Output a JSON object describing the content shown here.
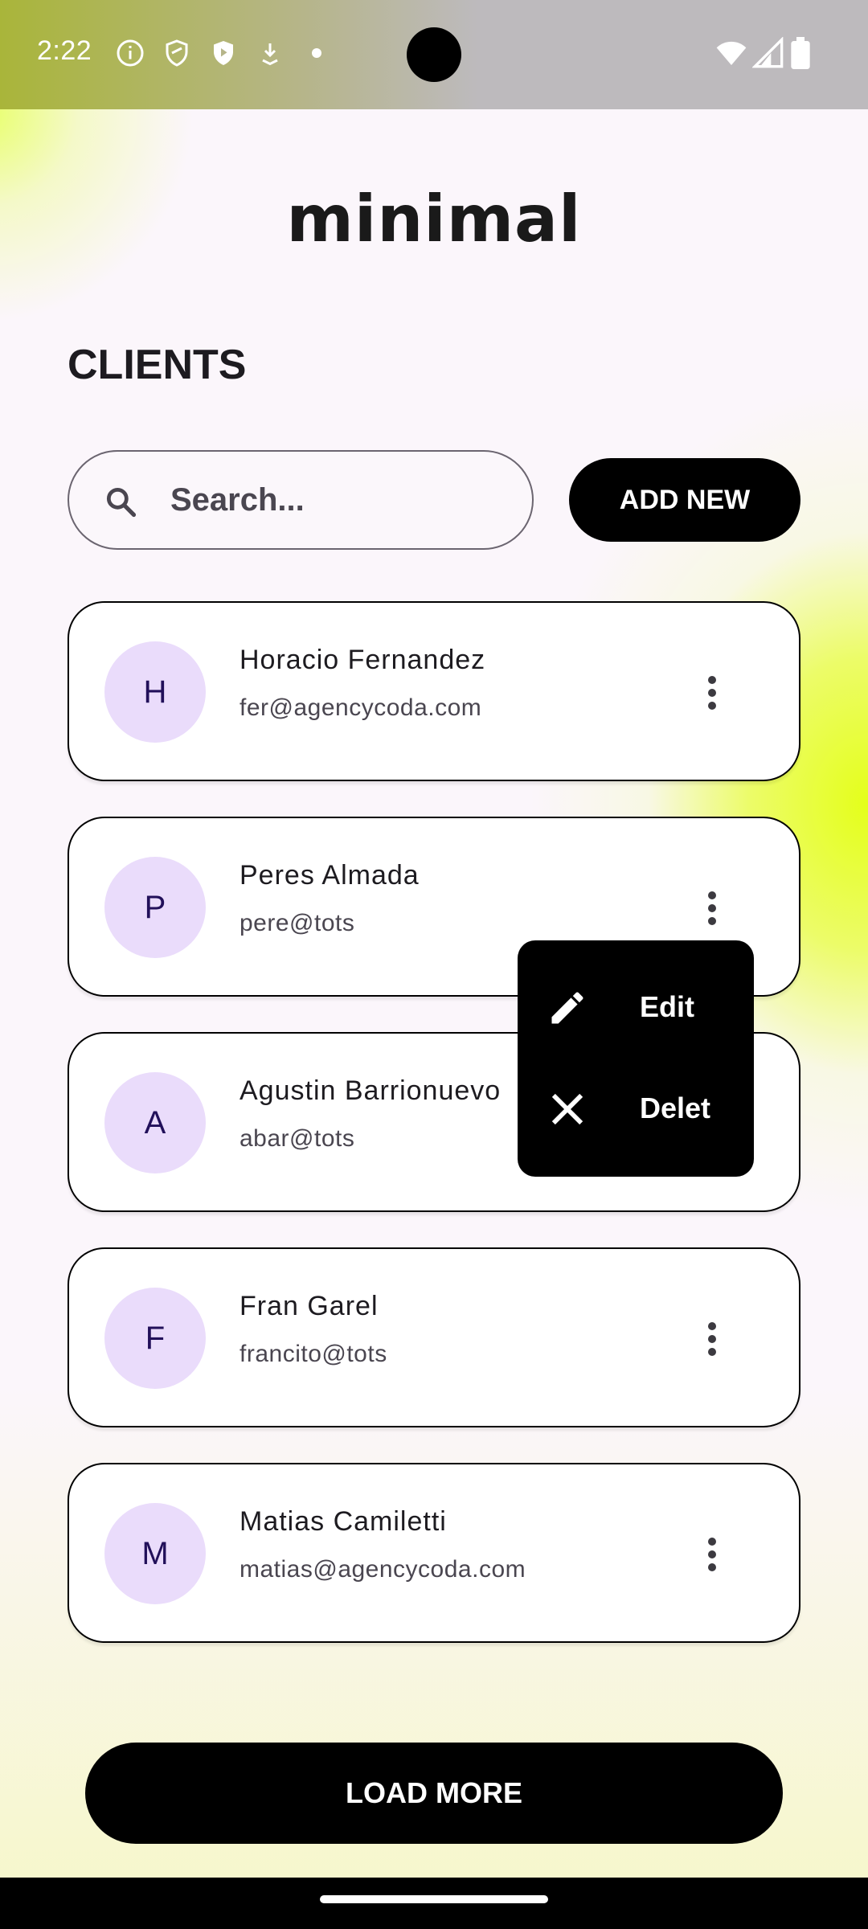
{
  "status_bar": {
    "time": "2:22",
    "icons": [
      "info-icon",
      "shield-outline-icon",
      "shield-play-icon",
      "download-icon",
      "dot-icon",
      "wifi-icon",
      "signal-icon",
      "battery-icon"
    ]
  },
  "app": {
    "logo": "minimal"
  },
  "clients": {
    "title": "CLIENTS",
    "search_placeholder": "Search...",
    "add_new_label": "ADD NEW",
    "items": [
      {
        "initial": "H",
        "name": "Horacio Fernandez",
        "email": "fer@agencycoda.com"
      },
      {
        "initial": "P",
        "name": "Peres Almada",
        "email": "pere@tots"
      },
      {
        "initial": "A",
        "name": "Agustin Barrionuevo",
        "email": "abar@tots"
      },
      {
        "initial": "F",
        "name": "Fran Garel",
        "email": "francito@tots"
      },
      {
        "initial": "M",
        "name": "Matias Camiletti",
        "email": "matias@agencycoda.com"
      }
    ],
    "load_more_label": "LOAD MORE"
  },
  "context_menu": {
    "items": [
      {
        "icon": "pencil-icon",
        "label": "Edit"
      },
      {
        "icon": "close-icon",
        "label": "Delet"
      }
    ]
  },
  "colors": {
    "accent_lime": "#e4ff1a",
    "avatar_bg": "#eadcfb",
    "avatar_text": "#22105a",
    "button_bg": "#000000"
  }
}
